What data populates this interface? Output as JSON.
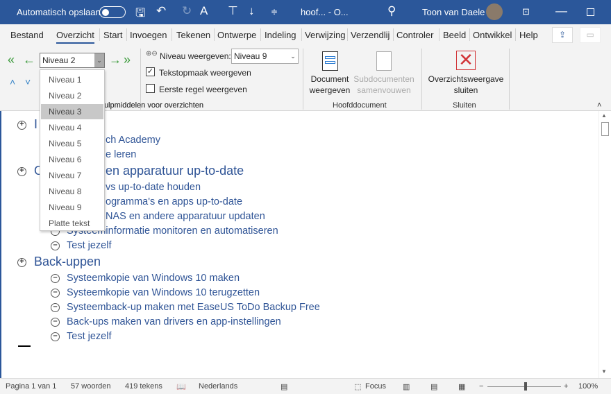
{
  "titlebar": {
    "autosave": "Automatisch opslaan",
    "doc_title": "hoof...  -  O...",
    "user": "Toon van Daele"
  },
  "tabs": [
    "Bestand",
    "Overzicht",
    "Start",
    "Invoegen",
    "Tekenen",
    "Ontwerpe",
    "Indeling",
    "Verwijzing",
    "Verzendlij",
    "Controler",
    "Beeld",
    "Ontwikkel",
    "Help"
  ],
  "ribbon": {
    "outline_level": "Niveau 2",
    "show_level_label": "Niveau weergeven:",
    "show_level_value": "Niveau 9",
    "show_formatting": "Tekstopmaak weergeven",
    "show_formatting_checked": true,
    "first_line_only": "Eerste regel weergeven",
    "first_line_only_checked": false,
    "group_tools": "Hulpmiddelen voor overzichten",
    "group_tools_visible": "ulpmiddelen voor overzichten",
    "show_document": [
      "Document",
      "weergeven"
    ],
    "collapse_subdocs": [
      "Subdocumenten",
      "samenvouwen"
    ],
    "group_master": "Hoofddocument",
    "close_outline": [
      "Overzichtsweergave",
      "sluiten"
    ],
    "group_close": "Sluiten"
  },
  "dropdown": {
    "items": [
      "Niveau 1",
      "Niveau 2",
      "Niveau 3",
      "Niveau 4",
      "Niveau 5",
      "Niveau 6",
      "Niveau 7",
      "Niveau 8",
      "Niveau 9",
      "Platte tekst"
    ],
    "selected": "Niveau 3"
  },
  "document": {
    "s1": {
      "heading": "I",
      "items": [
        "ch Academy",
        "e leren"
      ]
    },
    "s2": {
      "heading": "O",
      "heading_rest": "en apparatuur up-to-date",
      "items": [
        "vs up-to-date houden",
        "ogramma's en apps up-to-date",
        "NAS en andere apparatuur updaten",
        "Systeeminformatie monitoren en automatiseren",
        "Test jezelf"
      ]
    },
    "s3": {
      "heading": "Back-uppen",
      "items": [
        "Systeemkopie van Windows 10 maken",
        "Systeemkopie van Windows 10 terugzetten",
        "Systeemback-up maken met EaseUS ToDo Backup Free",
        "Back-ups maken van drivers en app-instellingen",
        "Test jezelf"
      ]
    }
  },
  "status": {
    "page": "Pagina 1 van 1",
    "words": "57 woorden",
    "chars": "419 tekens",
    "language": "Nederlands",
    "focus": "Focus",
    "zoom": "100%",
    "zoom_percent": 100
  }
}
